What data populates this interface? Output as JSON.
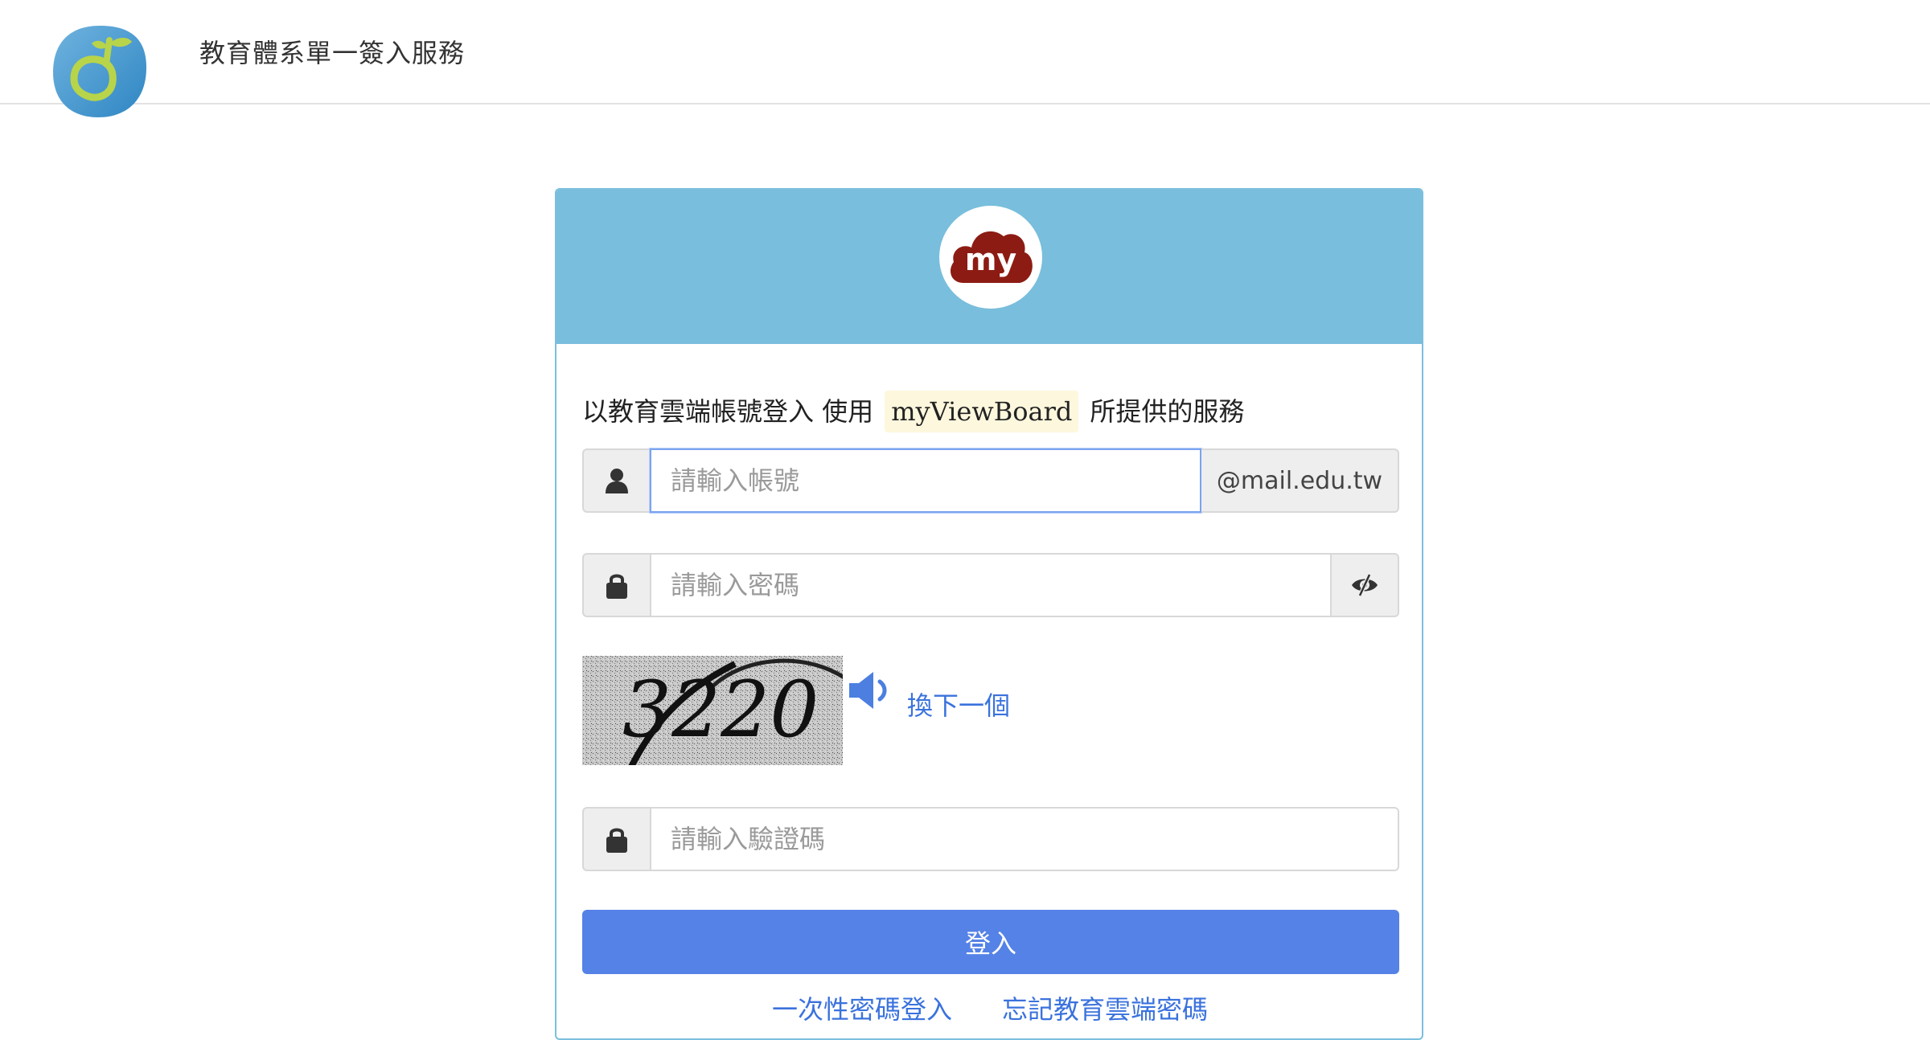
{
  "header": {
    "logo_icon": "education-cloud-sprout-logo",
    "title": "教育體系單一簽入服務"
  },
  "card": {
    "app_logo_text": "my",
    "intro_prefix": "以教育雲端帳號登入 使用",
    "app_name": "myViewBoard",
    "intro_suffix": "所提供的服務",
    "username": {
      "placeholder": "請輸入帳號",
      "value": "",
      "domain_suffix": "@mail.edu.tw",
      "icon": "user-icon"
    },
    "password": {
      "placeholder": "請輸入密碼",
      "value": "",
      "icon": "lock-icon",
      "toggle_icon": "eye-slash-icon"
    },
    "captcha": {
      "text": "3220",
      "audio_icon": "speaker-icon",
      "refresh_label": "換下一個"
    },
    "captcha_input": {
      "placeholder": "請輸入驗證碼",
      "value": "",
      "icon": "lock-icon"
    },
    "login_button": "登入",
    "otp_link": "一次性密碼登入",
    "forgot_link": "忘記教育雲端密碼"
  },
  "colors": {
    "card_header": "#79bedc",
    "primary_button": "#5582e6",
    "link": "#3a72dd",
    "app_logo_red": "#8c1c13"
  }
}
